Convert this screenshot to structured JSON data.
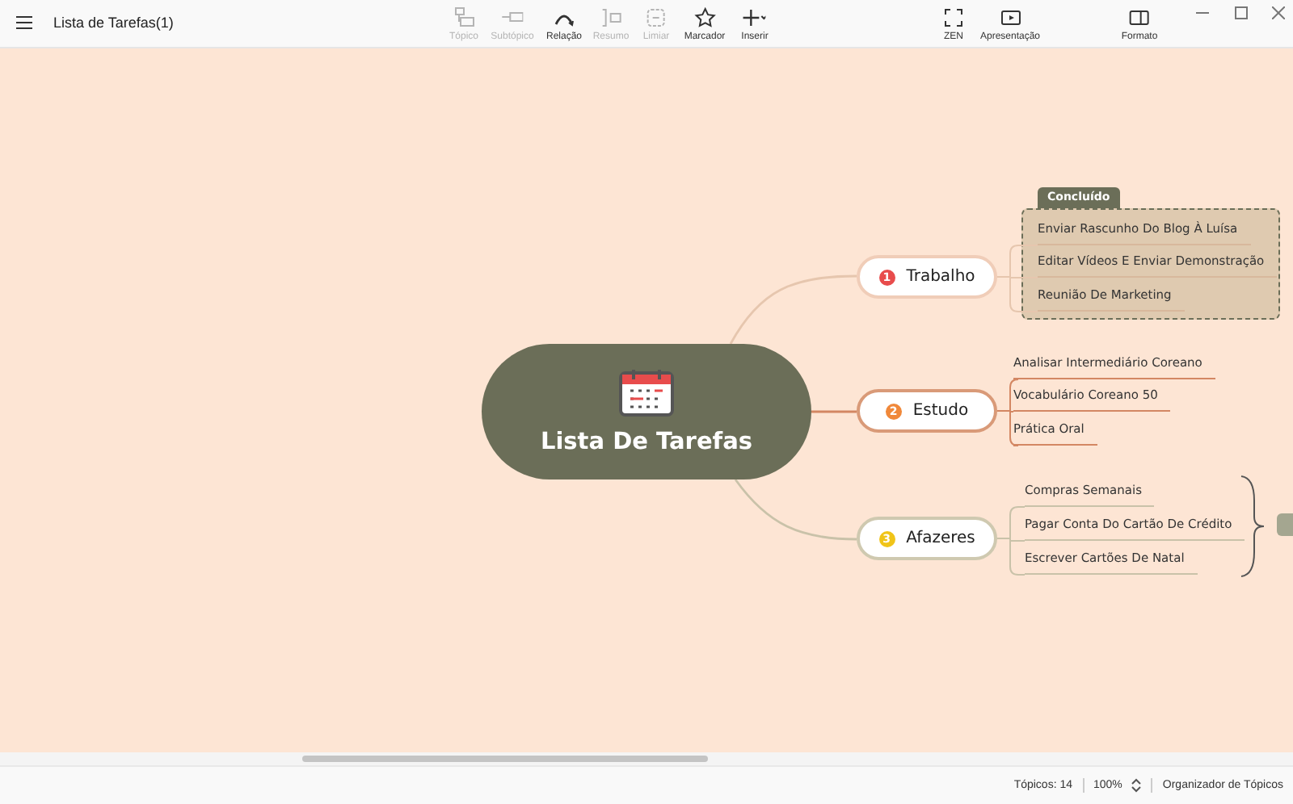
{
  "window": {
    "title": "Lista de Tarefas(1)"
  },
  "toolbar": {
    "tools": [
      {
        "kind": "topic",
        "label": "Tópico",
        "disabled": true
      },
      {
        "kind": "subtopic",
        "label": "Subtópico",
        "disabled": true
      },
      {
        "kind": "relation",
        "label": "Relação",
        "disabled": false
      },
      {
        "kind": "summary",
        "label": "Resumo",
        "disabled": true
      },
      {
        "kind": "boundary",
        "label": "Limiar",
        "disabled": true
      },
      {
        "kind": "marker",
        "label": "Marcador",
        "disabled": false
      },
      {
        "kind": "insert",
        "label": "Inserir",
        "disabled": false
      },
      {
        "kind": "zen",
        "label": "ZEN",
        "disabled": false
      },
      {
        "kind": "present",
        "label": "Apresentação",
        "disabled": false
      },
      {
        "kind": "format",
        "label": "Formato",
        "disabled": false
      }
    ]
  },
  "canvas": {
    "central_topic": {
      "title": "Lista De Tarefas"
    },
    "branches": [
      {
        "number": "1",
        "label": "Trabalho",
        "color": "#e84c4c",
        "boundary": {
          "label": "Concluído"
        },
        "children": [
          {
            "label": "Enviar Rascunho Do Blog À Luísa"
          },
          {
            "label": "Editar Vídeos E Enviar Demonstração"
          },
          {
            "label": "Reunião De Marketing"
          }
        ]
      },
      {
        "number": "2",
        "label": "Estudo",
        "color": "#f0883a",
        "children": [
          {
            "label": "Analisar Intermediário Coreano"
          },
          {
            "label": "Vocabulário Coreano 50"
          },
          {
            "label": "Prática Oral"
          }
        ]
      },
      {
        "number": "3",
        "label": "Afazeres",
        "color": "#f0c419",
        "summary": true,
        "children": [
          {
            "label": "Compras Semanais"
          },
          {
            "label": "Pagar Conta Do Cartão De Crédito"
          },
          {
            "label": "Escrever Cartões De Natal"
          }
        ]
      }
    ]
  },
  "status_bar": {
    "topics": "Tópicos: 14",
    "zoom": "100%",
    "panel_link": "Organizador de Tópicos"
  }
}
